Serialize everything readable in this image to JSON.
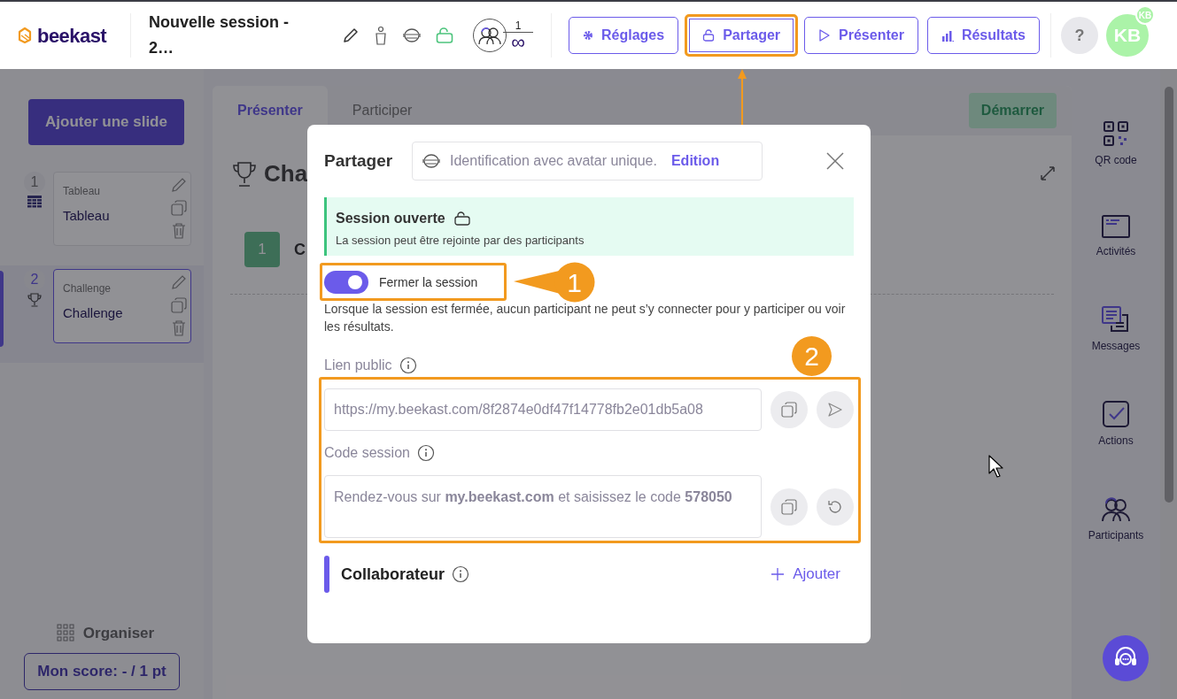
{
  "header": {
    "logo": "beekast",
    "session_title": "Nouvelle session - 2…",
    "participants_count": "1",
    "participants_limit": "∞",
    "buttons": [
      {
        "kind": "settings",
        "label": "Réglages",
        "highlighted": false
      },
      {
        "kind": "lock",
        "label": "Partager",
        "highlighted": true
      },
      {
        "kind": "play",
        "label": "Présenter",
        "highlighted": false
      },
      {
        "kind": "chart",
        "label": "Résultats",
        "highlighted": false
      }
    ],
    "help": "?",
    "avatar": "KB",
    "avatar_badge": "KB"
  },
  "left_panel": {
    "add_slide": "Ajouter une slide",
    "slides": [
      {
        "number": "1",
        "kind": "table",
        "type_label": "Tableau",
        "title": "Tableau",
        "selected": false
      },
      {
        "number": "2",
        "kind": "trophy",
        "type_label": "Challenge",
        "title": "Challenge",
        "selected": true
      }
    ],
    "organise": "Organiser",
    "score": "Mon score: - / 1 pt"
  },
  "center": {
    "tabs": [
      {
        "label": "Présenter",
        "selected": true
      },
      {
        "label": "Participer",
        "selected": false
      }
    ],
    "start": "Démarrer",
    "heading": "Cha",
    "item_number": "1",
    "item_text": "C"
  },
  "right_sidebar": {
    "items": [
      {
        "kind": "qr",
        "label": "QR code"
      },
      {
        "kind": "activities",
        "label": "Activités"
      },
      {
        "kind": "messages",
        "label": "Messages"
      },
      {
        "kind": "actions",
        "label": "Actions"
      },
      {
        "kind": "participants",
        "label": "Participants"
      }
    ]
  },
  "modal": {
    "title": "Partager",
    "identification": "Identification avec avatar unique.",
    "edit": "Edition",
    "status_title": "Session ouverte",
    "status_text": "La session peut être rejointe par des participants",
    "toggle": {
      "label": "Fermer la session",
      "on": true
    },
    "toggle_help": "Lorsque la session est fermée, aucun participant ne peut s’y connecter pour y participer ou voir les résultats.",
    "public_link_label": "Lien public",
    "public_link": "https://my.beekast.com/8f2874e0df47f14778fb2e01db5a08",
    "code_label": "Code session",
    "code_text": "Rendez-vous sur **my.beekast.com** et saisissez le code **578050**",
    "collaborator_title": "Collaborateur",
    "add": "Ajouter"
  },
  "annotations": [
    {
      "label": "1"
    },
    {
      "label": "2"
    }
  ]
}
